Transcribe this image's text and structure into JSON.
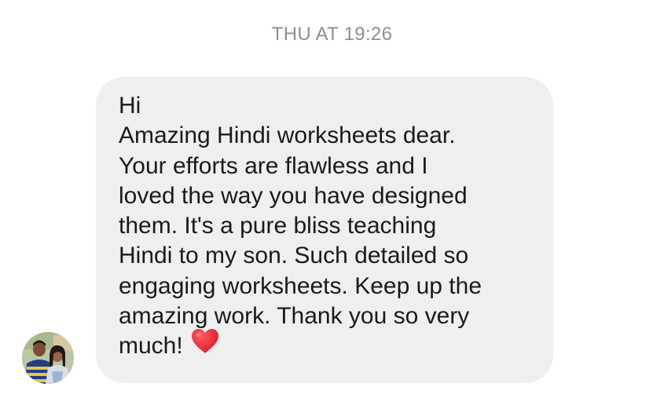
{
  "conversation": {
    "timestamp": "THU AT 19:26"
  },
  "message": {
    "lines": [
      "Hi",
      "Amazing Hindi worksheets dear.",
      "Your efforts are flawless and I",
      "loved the way you have designed",
      "them. It's a pure bliss teaching",
      "Hindi to my son. Such detailed so",
      "engaging worksheets. Keep up the",
      "amazing work. Thank you so very",
      "much!"
    ],
    "emoji": "red-heart-icon"
  },
  "colors": {
    "bubble": "#efefef",
    "timestamp": "#8e8e93",
    "text": "#1a1a1a",
    "heart": "#e0242f"
  }
}
